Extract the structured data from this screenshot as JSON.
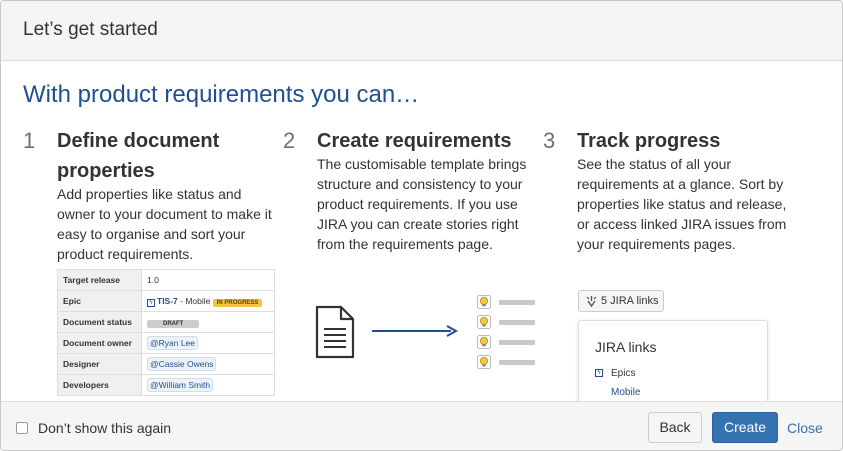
{
  "dialog": {
    "title": "Let’s get started",
    "heading": "With product requirements you can…"
  },
  "steps": [
    {
      "number": "1",
      "title": "Define document properties",
      "description": "Add properties like status and owner to your document to make it easy to organise and sort your product requirements."
    },
    {
      "number": "2",
      "title": "Create requirements",
      "description": "The customisable template brings structure and consistency to your product requirements. If you use JIRA you can create stories right from the requirements page."
    },
    {
      "number": "3",
      "title": "Track progress",
      "description": "See the status of all your requirements at a glance. Sort by properties like status and release, or access linked JIRA issues from your requirements pages."
    }
  ],
  "properties_table": {
    "rows": [
      {
        "key": "Target release",
        "value": "1.0"
      },
      {
        "key": "Epic",
        "issue_key": "TIS-7",
        "issue_suffix": " - Mobile",
        "status": "IN PROGRESS"
      },
      {
        "key": "Document status",
        "status": "DRAFT"
      },
      {
        "key": "Document owner",
        "mention": "@Ryan Lee"
      },
      {
        "key": "Designer",
        "mention": "@Cassie Owens"
      },
      {
        "key": "Developers",
        "mention": "@William Smith"
      }
    ]
  },
  "jira_widget": {
    "button_label": "5 JIRA links",
    "panel_title": "JIRA links",
    "epics_label": "Epics",
    "mobile_link": "Mobile"
  },
  "footer": {
    "checkbox_label": "Don’t show this again",
    "back_label": "Back",
    "create_label": "Create",
    "close_label": "Close"
  },
  "colors": {
    "heading_blue": "#1f4f8f",
    "primary_button": "#3572b0",
    "in_progress_lozenge": "#f6c342",
    "bulb_yellow": "#f5c842"
  },
  "icons": {
    "document": "document-icon",
    "arrow": "arrow-right-icon",
    "bulb": "lightbulb-icon",
    "jira_link": "jira-link-icon",
    "epic": "lightning-icon"
  }
}
